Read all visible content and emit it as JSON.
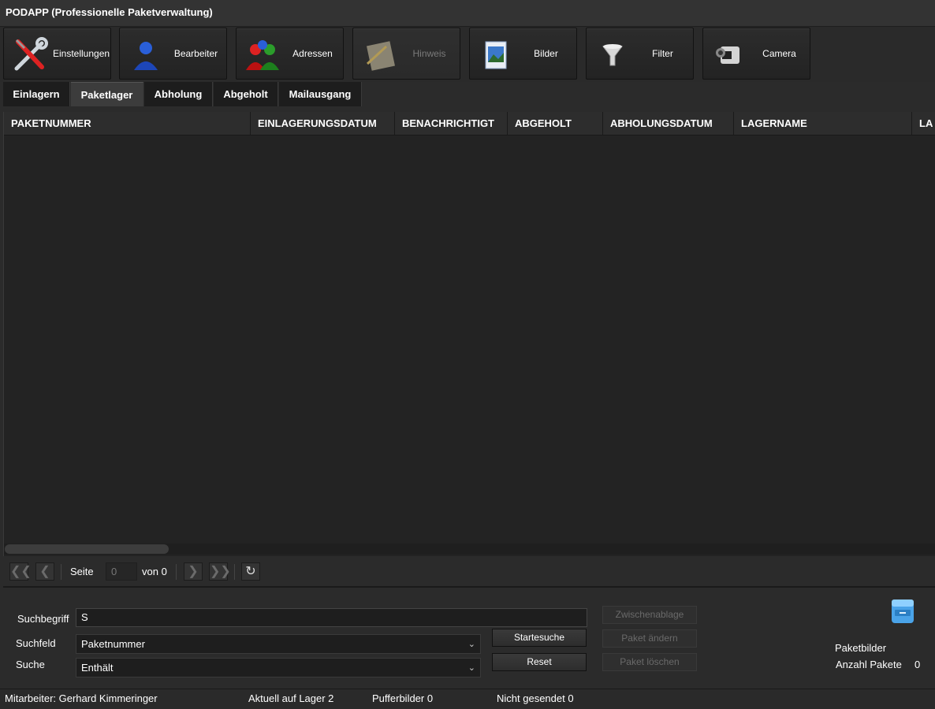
{
  "window": {
    "title": "PODAPP (Professionelle Paketverwaltung)"
  },
  "toolbar": {
    "buttons": [
      {
        "label": "Einstellungen",
        "icon": "tools-icon",
        "enabled": true
      },
      {
        "label": "Bearbeiter",
        "icon": "user-icon",
        "enabled": true
      },
      {
        "label": "Adressen",
        "icon": "users-group-icon",
        "enabled": true
      },
      {
        "label": "Hinweis",
        "icon": "notepad-icon",
        "enabled": false
      },
      {
        "label": "Bilder",
        "icon": "picture-icon",
        "enabled": true
      },
      {
        "label": "Filter",
        "icon": "funnel-icon",
        "enabled": true
      },
      {
        "label": "Camera",
        "icon": "camcorder-icon",
        "enabled": true
      }
    ]
  },
  "tabs": [
    {
      "label": "Einlagern",
      "active": false
    },
    {
      "label": "Paketlager",
      "active": true
    },
    {
      "label": "Abholung",
      "active": false
    },
    {
      "label": "Abgeholt",
      "active": false
    },
    {
      "label": "Mailausgang",
      "active": false
    }
  ],
  "table": {
    "columns": [
      "PAKETNUMMER",
      "EINLAGERUNGSDATUM",
      "BENACHRICHTIGT",
      "ABGEHOLT",
      "ABHOLUNGSDATUM",
      "LAGERNAME",
      "LA"
    ],
    "rows": []
  },
  "pager": {
    "page_label": "Seite",
    "page_value": "0",
    "of_label": "von 0"
  },
  "search": {
    "term_label": "Suchbegriff",
    "term_value": "S",
    "field_label": "Suchfeld",
    "field_value": "Paketnummer",
    "mode_label": "Suche",
    "mode_value": "Enthält",
    "start_button": "Startesuche",
    "reset_button": "Reset",
    "clipboard_button": "Zwischenablage",
    "edit_button": "Paket ändern",
    "delete_button": "Paket löschen"
  },
  "info": {
    "images_label": "Paketbilder",
    "count_label": "Anzahl Pakete",
    "count_value": "0"
  },
  "status": {
    "employee": "Mitarbeiter: Gerhard Kimmeringer",
    "storage": "Aktuell auf Lager 2",
    "buffer": "Pufferbilder 0",
    "unsent": "Nicht gesendet 0"
  }
}
